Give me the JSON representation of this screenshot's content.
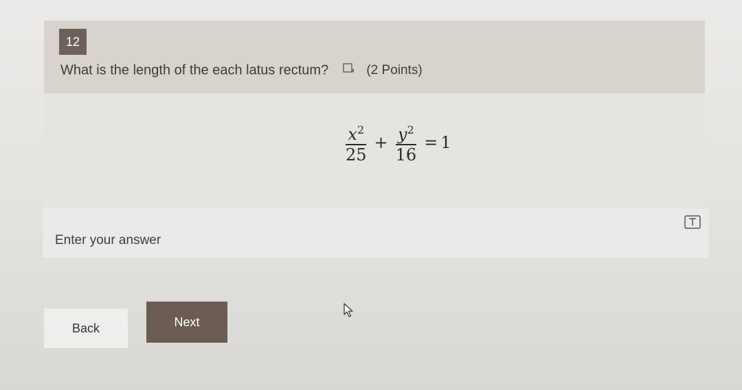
{
  "question": {
    "number": "12",
    "text": "What is the length of the each latus rectum?",
    "points": "(2 Points)",
    "reader_icon": "immersive-reader-icon"
  },
  "equation": {
    "term1_numerator": "x",
    "term1_exponent": "2",
    "term1_denominator": "25",
    "operator": "+",
    "term2_numerator": "y",
    "term2_exponent": "2",
    "term2_denominator": "16",
    "equals": "=",
    "result": "1"
  },
  "answer": {
    "placeholder": "Enter your answer",
    "value": "",
    "format_icon": "text-format-icon"
  },
  "navigation": {
    "back_label": "Back",
    "next_label": "Next"
  },
  "colors": {
    "accent": "#6d5c54",
    "badge": "#6d625b"
  }
}
